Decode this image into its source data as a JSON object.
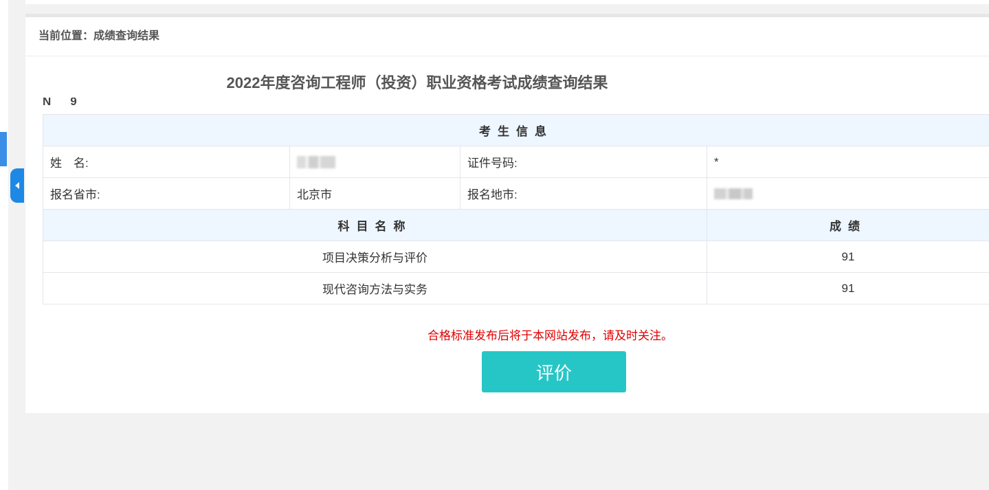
{
  "breadcrumb": {
    "prefix": "当前位置：",
    "current": "成绩查询结果"
  },
  "title": "2022年度咨询工程师（投资）职业资格考试成绩查询结果",
  "no_line": {
    "visible_start": "N",
    "visible_end": "9"
  },
  "candidate": {
    "section_header": "考生信息",
    "name_label": "姓　名:",
    "id_label": "证件号码:",
    "id_value": "*",
    "province_label": "报名省市:",
    "province_value": "北京市",
    "city_label": "报名地市:"
  },
  "scores": {
    "subject_header": "科目名称",
    "score_header": "成绩",
    "rows": [
      {
        "subject": "项目决策分析与评价",
        "score": "91"
      },
      {
        "subject": "现代咨询方法与实务",
        "score": "91"
      }
    ]
  },
  "notice": "合格标准发布后将于本网站发布，请及时关注。",
  "evaluate_button": "评价",
  "colors": {
    "accent": "#26c6c6",
    "notice": "#e00000",
    "header_bg": "#eef6ff",
    "sidebar_tab": "#1e88e5"
  },
  "icons": {
    "collapse": "caret-left-icon"
  }
}
